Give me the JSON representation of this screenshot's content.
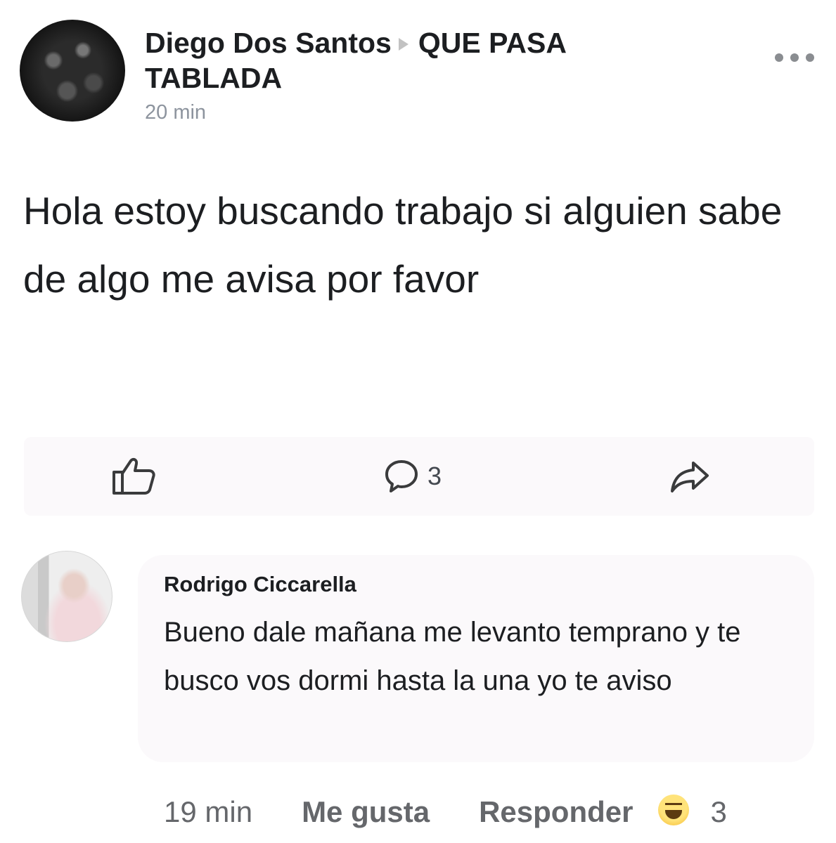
{
  "post": {
    "author": "Diego Dos Santos",
    "group_line1": "QUE PASA",
    "group_line2": "TABLADA",
    "time": "20 min",
    "body": "Hola estoy buscando trabajo si alguien sabe de algo me avisa por favor",
    "comment_count": "3",
    "icons": [
      "more-icon",
      "like-icon",
      "comment-icon",
      "share-icon"
    ]
  },
  "comment": {
    "author": "Rodrigo Ciccarella",
    "text": "Bueno dale mañana me levanto temprano y te busco vos dormi hasta la una yo te aviso",
    "time": "19 min",
    "like_label": "Me gusta",
    "reply_label": "Responder",
    "reaction_icon": "haha-icon",
    "reaction_count": "3"
  },
  "colors": {
    "text": "#1c1e21",
    "secondary": "#65676b",
    "bubble": "#fbf9fb"
  }
}
